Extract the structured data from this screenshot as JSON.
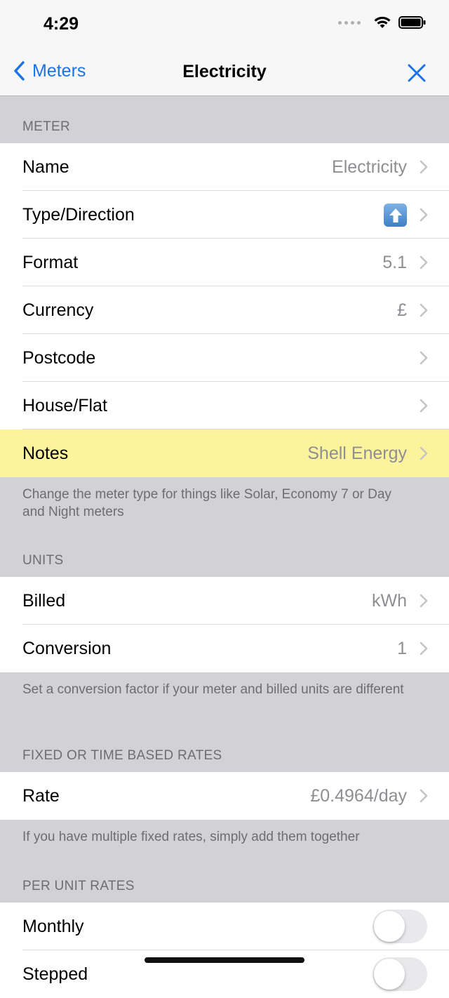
{
  "status": {
    "time": "4:29"
  },
  "nav": {
    "back_label": "Meters",
    "title": "Electricity"
  },
  "sections": {
    "meter": {
      "header": "METER",
      "rows": [
        {
          "label": "Name",
          "value": "Electricity"
        },
        {
          "label": "Type/Direction",
          "value": ""
        },
        {
          "label": "Format",
          "value": "5.1"
        },
        {
          "label": "Currency",
          "value": "£"
        },
        {
          "label": "Postcode",
          "value": ""
        },
        {
          "label": "House/Flat",
          "value": ""
        },
        {
          "label": "Notes",
          "value": "Shell Energy"
        }
      ],
      "footer": "Change the meter type for things like Solar, Economy 7 or Day and Night meters"
    },
    "units": {
      "header": "UNITS",
      "rows": [
        {
          "label": "Billed",
          "value": "kWh"
        },
        {
          "label": "Conversion",
          "value": "1"
        }
      ],
      "footer": "Set a conversion factor if your meter and billed units are different"
    },
    "fixed": {
      "header": "FIXED OR TIME BASED RATES",
      "rows": [
        {
          "label": "Rate",
          "value": "£0.4964/day"
        }
      ],
      "footer": "If you have multiple fixed rates, simply add them together"
    },
    "per_unit": {
      "header": "PER UNIT RATES",
      "rows": [
        {
          "label": "Monthly",
          "toggle_on": false
        },
        {
          "label": "Stepped",
          "toggle_on": false
        }
      ]
    }
  },
  "icons": {
    "type_direction": "arrow-up-box-icon",
    "chevron": "chevron-right-icon",
    "back": "chevron-left-icon",
    "close": "close-icon"
  },
  "colors": {
    "accent": "#1a73e8",
    "highlight_row": "#fdf39c",
    "grouped_background": "#d1d1d6"
  }
}
